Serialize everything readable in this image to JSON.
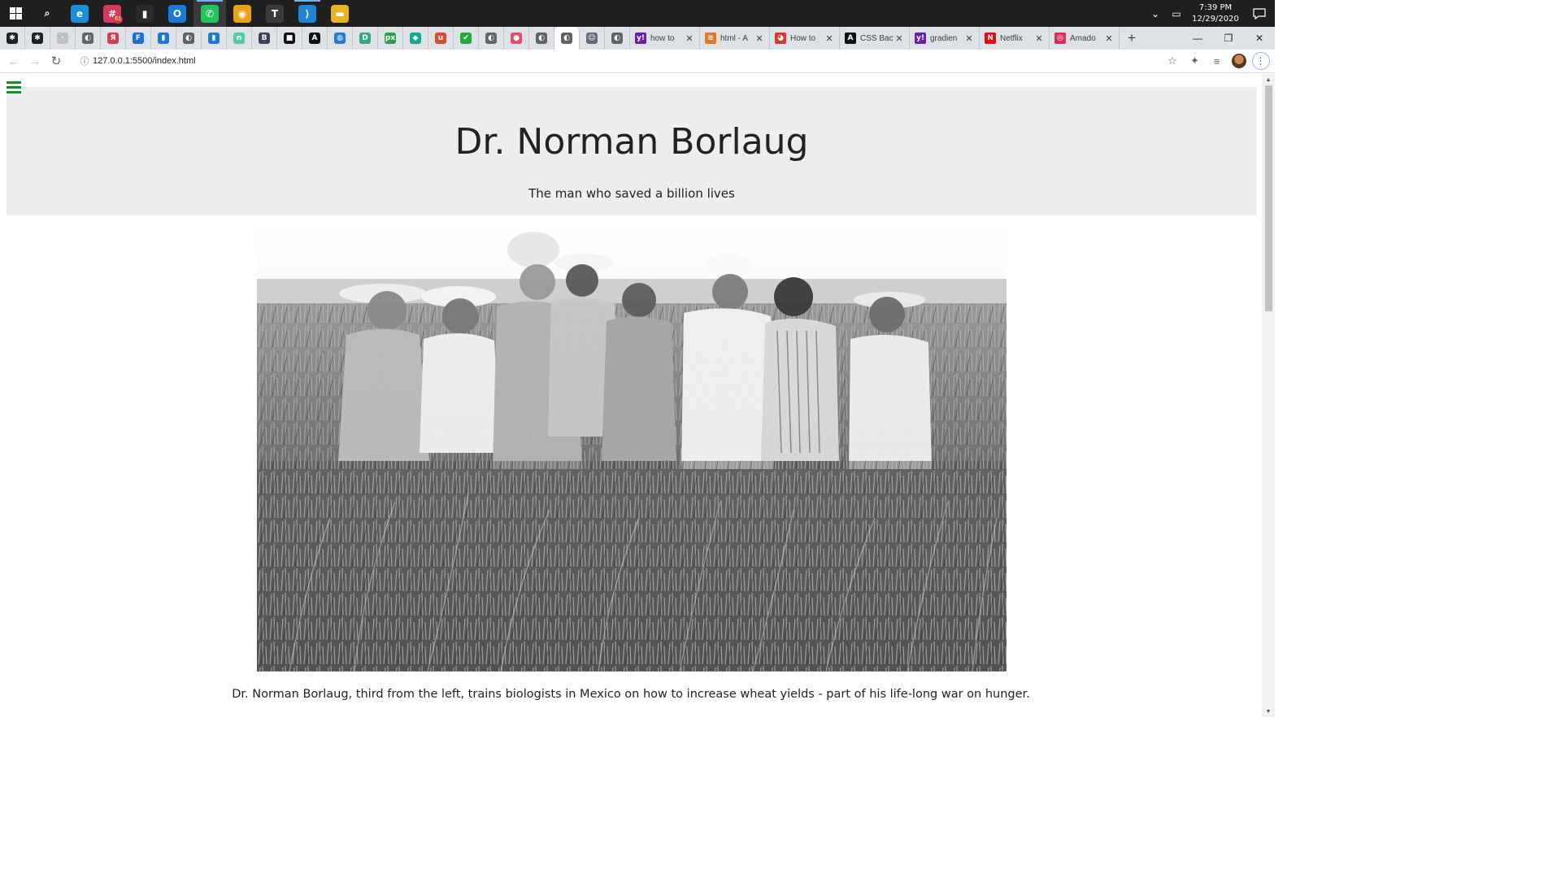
{
  "taskbar": {
    "apps": [
      {
        "name": "search",
        "glyph": "⌕",
        "color": "#1f1f1f"
      },
      {
        "name": "edge",
        "glyph": "e",
        "color": "#1b8fd8"
      },
      {
        "name": "slack",
        "glyph": "#",
        "color": "#d53a5a"
      },
      {
        "name": "charts",
        "glyph": "▮",
        "color": "#2a2a2a"
      },
      {
        "name": "outlook",
        "glyph": "O",
        "color": "#1b7ad6"
      },
      {
        "name": "whatsapp",
        "glyph": "✆",
        "color": "#25c35f"
      },
      {
        "name": "chrome",
        "glyph": "◉",
        "color": "#e8a217"
      },
      {
        "name": "typora",
        "glyph": "T",
        "color": "#3a3a3a"
      },
      {
        "name": "vscode",
        "glyph": "⟩",
        "color": "#1f86d6"
      },
      {
        "name": "file-explorer",
        "glyph": "▬",
        "color": "#e8b425"
      }
    ],
    "slack_badge": "61",
    "time": "7:39 PM",
    "date": "12/29/2020"
  },
  "tabs": {
    "pinned": [
      {
        "glyph": "✱",
        "color": "#202124"
      },
      {
        "glyph": "✱",
        "color": "#202124"
      },
      {
        "glyph": "·",
        "color": "#c0c0c0"
      },
      {
        "glyph": "◐",
        "color": "#5f6368"
      },
      {
        "glyph": "Я",
        "color": "#d0404a"
      },
      {
        "glyph": "F",
        "color": "#1b6fd8"
      },
      {
        "glyph": "▮",
        "color": "#1b7ad6"
      },
      {
        "glyph": "◐",
        "color": "#5f6368"
      },
      {
        "glyph": "▮",
        "color": "#1b7ad6"
      },
      {
        "glyph": "п",
        "color": "#58c9a8"
      },
      {
        "glyph": "B",
        "color": "#3f3f5f"
      },
      {
        "glyph": "■",
        "color": "#111111"
      },
      {
        "glyph": "A",
        "color": "#101018"
      },
      {
        "glyph": "◍",
        "color": "#2a78d6"
      },
      {
        "glyph": "D",
        "color": "#35a88a"
      },
      {
        "glyph": "px",
        "color": "#2e9e4a"
      },
      {
        "glyph": "◆",
        "color": "#18a890"
      },
      {
        "glyph": "u",
        "color": "#d64a3a"
      },
      {
        "glyph": "✔",
        "color": "#26a83a"
      },
      {
        "glyph": "◐",
        "color": "#5f6368"
      },
      {
        "glyph": "●",
        "color": "#e84a6a"
      },
      {
        "glyph": "◐",
        "color": "#5f6368"
      },
      {
        "glyph": "◐",
        "color": "#5f6368",
        "active": true
      },
      {
        "glyph": "☺",
        "color": "#6a6a7a"
      },
      {
        "glyph": "◐",
        "color": "#5f6368"
      }
    ],
    "titled": [
      {
        "glyph": "y!",
        "color": "#6a1fb0",
        "label": "how to"
      },
      {
        "glyph": "≋",
        "color": "#e07a2a",
        "label": "html - A"
      },
      {
        "glyph": "◕",
        "color": "#d63a2a",
        "label": "How to"
      },
      {
        "glyph": "A",
        "color": "#101018",
        "label": "CSS Bac"
      },
      {
        "glyph": "y!",
        "color": "#6a1fb0",
        "label": "gradien"
      },
      {
        "glyph": "N",
        "color": "#e50914",
        "label": "Netflix"
      },
      {
        "glyph": "◎",
        "color": "#d6305a",
        "label": "Amado"
      }
    ]
  },
  "address_bar": {
    "url": "127.0.0.1:5500/index.html"
  },
  "page": {
    "title": "Dr. Norman Borlaug",
    "tagline": "The man who saved a billion lives",
    "photo_alt": "Black-and-white photo of Norman Borlaug with a group of men in a wheat field",
    "caption": "Dr. Norman Borlaug, third from the left, trains biologists in Mexico on how to increase wheat yields - part of his life-long war on hunger."
  }
}
